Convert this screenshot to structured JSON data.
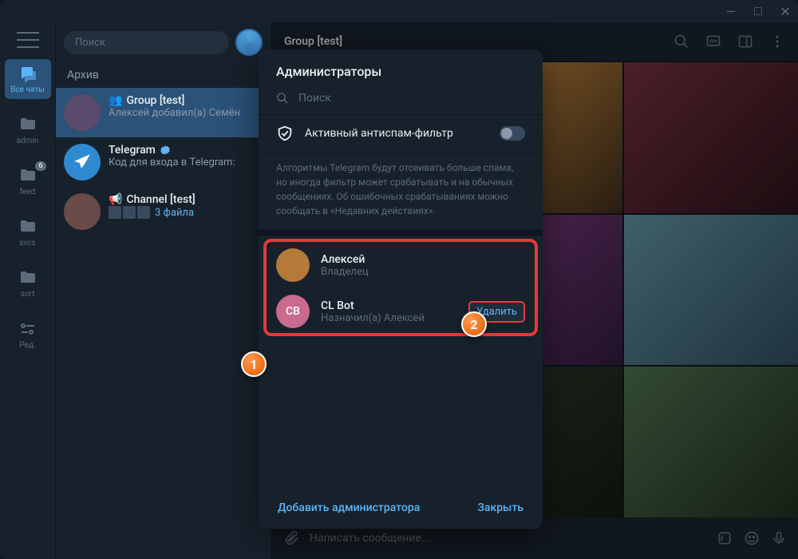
{
  "titlebar": {
    "minimize": "—",
    "maximize": "□",
    "close": "✕"
  },
  "rail": {
    "all_chats": "Все чаты",
    "items": [
      {
        "label": "admin"
      },
      {
        "label": "feed",
        "badge": "6"
      },
      {
        "label": "svcs"
      },
      {
        "label": "sort"
      },
      {
        "label": "Ред."
      }
    ]
  },
  "search": {
    "placeholder": "Поиск"
  },
  "archive_label": "Архив",
  "chats": [
    {
      "title": "Group [test]",
      "sub": "Алексей добавил(а) Семён",
      "icon": "👥",
      "avatar_bg": "#5a4a6b"
    },
    {
      "title": "Telegram",
      "sub": "Код для входа в Telegram:",
      "verified": true,
      "avatar_bg": "#2f8ad1"
    },
    {
      "title": "Channel [test]",
      "sub": "3 файла",
      "icon": "📢",
      "avatar_bg": "#6b4a4a",
      "thumbs": true
    }
  ],
  "header": {
    "title": "Group [test]"
  },
  "compose": {
    "placeholder": "Написать сообщение..."
  },
  "modal": {
    "title": "Администраторы",
    "search_placeholder": "Поиск",
    "antispam_label": "Активный антиспам-фильтр",
    "antispam_desc": "Алгоритмы Telegram будут отсеивать больше спама, но иногда фильтр может срабатывать и на обычных сообщениях. Об ошибочных срабатываниях можно сообщать в «Недавних действиях».",
    "admins": [
      {
        "name": "Алексей",
        "role": "Владелец",
        "avatar_bg": "#b57a3a",
        "initials": ""
      },
      {
        "name": "CL Bot",
        "role": "Назначил(а) Алексей",
        "avatar_bg": "#c96a8f",
        "initials": "CB",
        "deletable": true
      }
    ],
    "delete_label": "Удалить",
    "add_label": "Добавить администратора",
    "close_label": "Закрыть"
  },
  "callouts": {
    "c1": "1",
    "c2": "2"
  },
  "media_colors": [
    [
      "#8a5a2e",
      "#2e1a0e"
    ],
    [
      "#c98a3a",
      "#3a2a1a"
    ],
    [
      "#6b2e3a",
      "#2a1218"
    ],
    [
      "#3a2e6b",
      "#1a1230"
    ],
    [
      "#7a3a7a",
      "#2e1a3a"
    ],
    [
      "#5a8a9a",
      "#2e4a5a"
    ],
    [
      "#3a5a2e",
      "#1a2e12"
    ],
    [
      "#2e3a2a",
      "#121a10"
    ],
    [
      "#4a6a4a",
      "#1e2e1e"
    ]
  ]
}
